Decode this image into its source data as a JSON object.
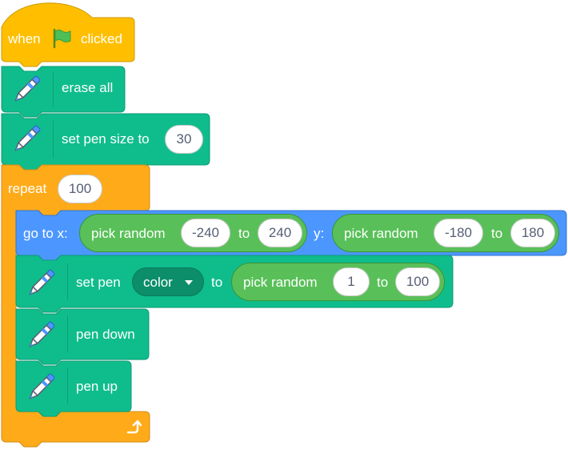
{
  "colors": {
    "events": "#ffbf00",
    "pen": "#0fbd8c",
    "control": "#ffab19",
    "motion": "#4c97ff",
    "operators": "#59c059"
  },
  "hat": {
    "label_when": "when",
    "flag_icon": "green-flag-icon",
    "label_clicked": "clicked"
  },
  "erase": {
    "label": "erase all"
  },
  "pen_size": {
    "label": "set pen size to",
    "value": "30"
  },
  "repeat": {
    "label": "repeat",
    "value": "100",
    "loop_icon": "loop-arrow-icon"
  },
  "goto": {
    "label_x": "go to x:",
    "random_x": {
      "label": "pick random",
      "from": "-240",
      "to_label": "to",
      "to": "240"
    },
    "label_y": "y:",
    "random_y": {
      "label": "pick random",
      "from": "-180",
      "to_label": "to",
      "to": "180"
    }
  },
  "set_pen": {
    "label": "set pen",
    "dropdown": "color",
    "to_label": "to",
    "random": {
      "label": "pick random",
      "from": "1",
      "to_label": "to",
      "to": "100"
    }
  },
  "pen_down": {
    "label": "pen down"
  },
  "pen_up": {
    "label": "pen up"
  }
}
